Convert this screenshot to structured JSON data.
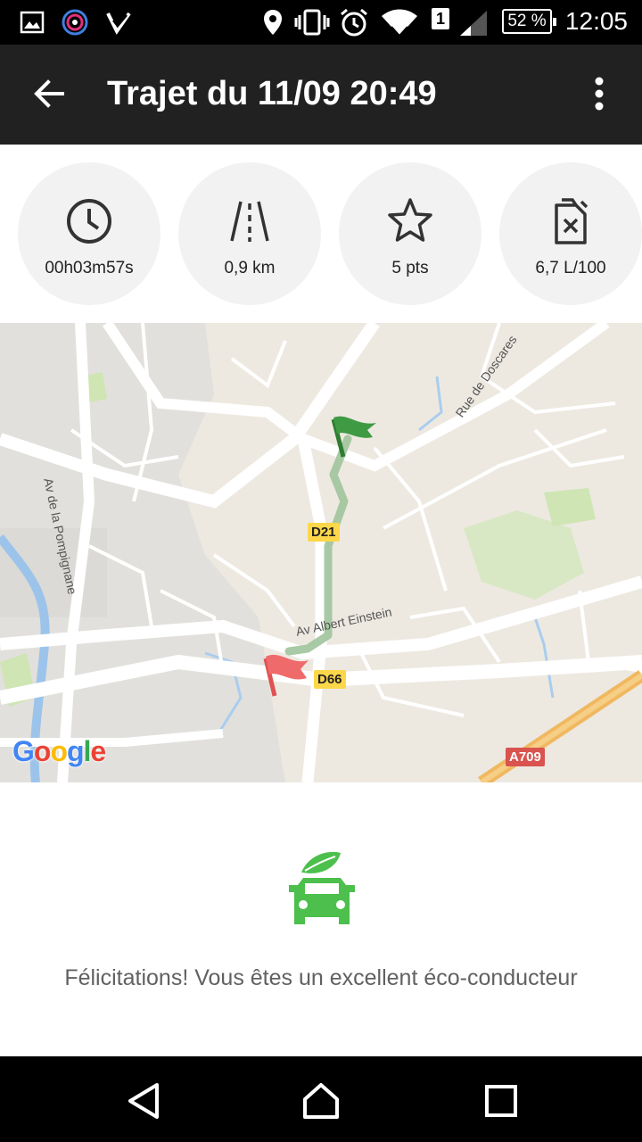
{
  "status_bar": {
    "battery": "52 %",
    "time": "12:05",
    "sim": "1",
    "icons": [
      "image-icon",
      "app-icon",
      "check-app-icon",
      "location-icon",
      "vibrate-icon",
      "alarm-icon",
      "wifi-icon",
      "sim-icon",
      "signal-icon",
      "battery-icon"
    ]
  },
  "app_bar": {
    "title": "Trajet du 11/09 20:49",
    "back_icon": "arrow-back-icon",
    "menu_icon": "more-vert-icon"
  },
  "stats": [
    {
      "icon": "clock-icon",
      "value": "00h03m57s"
    },
    {
      "icon": "road-icon",
      "value": "0,9 km"
    },
    {
      "icon": "star-icon",
      "value": "5 pts"
    },
    {
      "icon": "fuel-can-icon",
      "value": "6,7 L/100"
    }
  ],
  "map": {
    "road_labels": [
      "D21",
      "D66",
      "A709"
    ],
    "street_labels": [
      "Rue de Doscares",
      "Av de la Pompignane",
      "Av Albert Einstein"
    ],
    "logo": "Google",
    "start_flag_color": "#d32f2f",
    "end_flag_color": "#2e7d32",
    "route_color": "#a5c9a3"
  },
  "eco": {
    "icon": "eco-car-icon",
    "message": "Félicitations! Vous êtes un excellent éco-conducteur",
    "accent": "#4cbf4c"
  },
  "nav_bar": {
    "icons": [
      "nav-back-icon",
      "nav-home-icon",
      "nav-recents-icon"
    ]
  }
}
